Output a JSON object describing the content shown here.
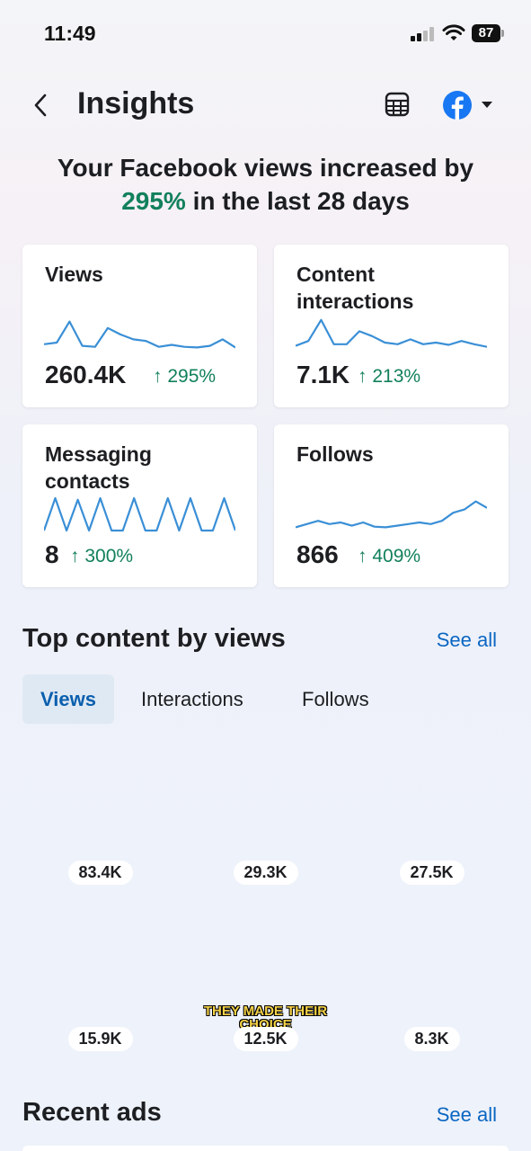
{
  "status": {
    "time": "11:49",
    "battery": "87"
  },
  "header": {
    "title": "Insights"
  },
  "headline": {
    "line1": "Your Facebook views increased by",
    "pct": "295%",
    "line2": " in the last 28 days"
  },
  "cards": [
    {
      "label": "Views",
      "value": "260.4K",
      "delta": "↑ 295%",
      "spark": [
        0.2,
        0.25,
        0.9,
        0.15,
        0.12,
        0.7,
        0.5,
        0.35,
        0.3,
        0.12,
        0.18,
        0.12,
        0.1,
        0.15,
        0.35,
        0.1
      ]
    },
    {
      "label": "Content interactions",
      "value": "7.1K",
      "delta": "↑ 213%",
      "spark": [
        0.15,
        0.3,
        0.95,
        0.2,
        0.2,
        0.6,
        0.45,
        0.25,
        0.2,
        0.35,
        0.2,
        0.25,
        0.18,
        0.3,
        0.2,
        0.12
      ]
    },
    {
      "label": "Messaging contacts",
      "value": "8",
      "delta": "↑ 300%",
      "spark": [
        0,
        1,
        0,
        0.95,
        0,
        1,
        0,
        0,
        1,
        0,
        0,
        1,
        0,
        1,
        0,
        0,
        1,
        0
      ]
    },
    {
      "label": "Follows",
      "value": "866",
      "delta": "↑ 409%",
      "spark": [
        0.1,
        0.2,
        0.3,
        0.2,
        0.25,
        0.15,
        0.25,
        0.12,
        0.1,
        0.15,
        0.2,
        0.25,
        0.2,
        0.3,
        0.55,
        0.65,
        0.9,
        0.7
      ]
    }
  ],
  "top_content": {
    "title": "Top content by views",
    "see_all": "See all",
    "tabs": [
      "Views",
      "Interactions",
      "Follows"
    ],
    "items": [
      {
        "views": "83.4K",
        "colors": [
          "#c8a2d6",
          "#3f7a2e",
          "#e8d9c2"
        ]
      },
      {
        "views": "29.3K",
        "colors": [
          "#e7e2da",
          "#2b3e6b",
          "#d86a6a"
        ]
      },
      {
        "views": "27.5K",
        "colors": [
          "#3a3a3a",
          "#f2f0ec",
          "#6b4a3a"
        ]
      },
      {
        "views": "15.9K",
        "colors": [
          "#e6e6e6",
          "#1a1a1a",
          "#ffffff"
        ]
      },
      {
        "views": "12.5K",
        "colors": [
          "#d9d6cf",
          "#7a96c8",
          "#6e4a3a"
        ],
        "overlay": "THEY MADE THEIR CHOICE"
      },
      {
        "views": "8.3K",
        "colors": [
          "#0f1730",
          "#2a3f78",
          "#4b5d8f"
        ]
      }
    ]
  },
  "recent_ads": {
    "title": "Recent ads",
    "see_all": "See all"
  }
}
